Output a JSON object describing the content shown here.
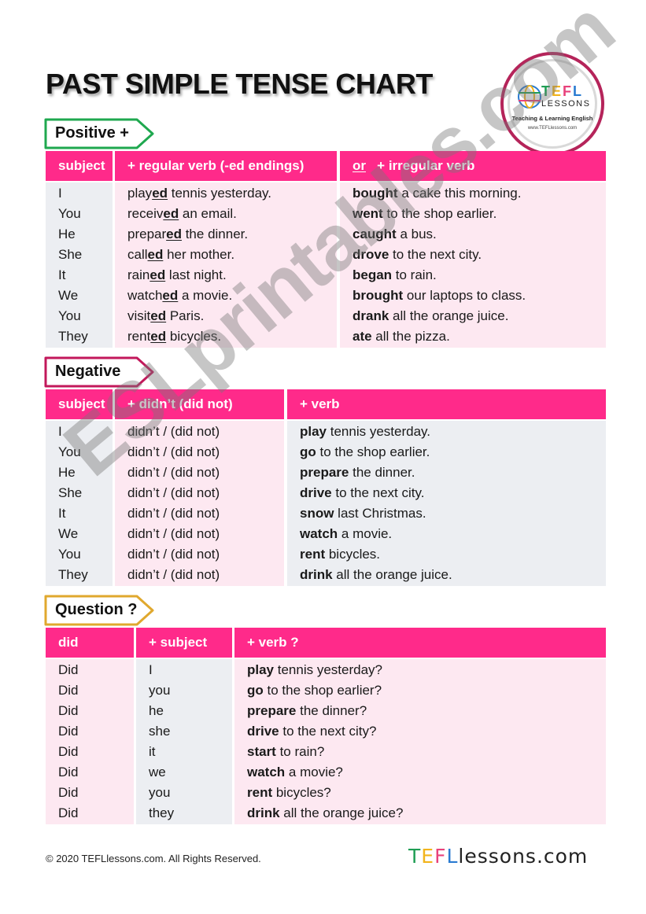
{
  "title": "PAST SIMPLE TENSE CHART",
  "logo": {
    "letters": [
      "T",
      "E",
      "F",
      "L"
    ],
    "lessons": "LESSONS",
    "tagline": "Teaching  & Learning English",
    "url": "www.TEFLlessons.com"
  },
  "colors": {
    "header": "#ff2a8a",
    "positive_tab": "#1fa84f",
    "negative_tab": "#c2185b",
    "question_tab": "#e0a82e",
    "pink_cell": "#fde8f1",
    "grey_cell": "#eceef2"
  },
  "positive": {
    "tab_label": "Positive +",
    "headers": [
      "subject",
      "+ regular verb (-ed endings)",
      "or",
      "+ irregular verb"
    ],
    "subjects": [
      "I",
      "You",
      "He",
      "She",
      "It",
      "We",
      "You",
      "They"
    ],
    "regular": [
      {
        "stem": "play",
        "ending": "ed",
        "rest": " tennis yesterday."
      },
      {
        "stem": "receiv",
        "ending": "ed",
        "rest": " an email."
      },
      {
        "stem": "prepar",
        "ending": "ed",
        "rest": " the dinner."
      },
      {
        "stem": "call",
        "ending": "ed",
        "rest": " her mother."
      },
      {
        "stem": "rain",
        "ending": "ed",
        "rest": " last night."
      },
      {
        "stem": "watch",
        "ending": "ed",
        "rest": " a movie."
      },
      {
        "stem": "visit",
        "ending": "ed",
        "rest": " Paris."
      },
      {
        "stem": "rent",
        "ending": "ed",
        "rest": " bicycles."
      }
    ],
    "irregular": [
      {
        "verb": "bought",
        "rest": " a cake this morning."
      },
      {
        "verb": "went",
        "rest": " to the shop earlier."
      },
      {
        "verb": "caught",
        "rest": " a bus."
      },
      {
        "verb": "drove",
        "rest": " to the next city."
      },
      {
        "verb": "began",
        "rest": " to rain."
      },
      {
        "verb": "brought",
        "rest": " our laptops to class."
      },
      {
        "verb": "drank",
        "rest": " all the orange juice."
      },
      {
        "verb": "ate",
        "rest": " all the pizza."
      }
    ]
  },
  "negative": {
    "tab_label": "Negative",
    "headers": [
      "subject",
      "+ didn’t (did not)",
      "+ verb"
    ],
    "subjects": [
      "I",
      "You",
      "He",
      "She",
      "It",
      "We",
      "You",
      "They"
    ],
    "auxiliary": [
      "didn’t / (did not)",
      "didn’t / (did not)",
      "didn’t / (did not)",
      "didn’t / (did not)",
      "didn’t / (did not)",
      "didn’t / (did not)",
      "didn’t / (did not)",
      "didn’t / (did not)"
    ],
    "verbs": [
      {
        "verb": "play",
        "rest": " tennis yesterday."
      },
      {
        "verb": "go",
        "rest": " to the shop earlier."
      },
      {
        "verb": "prepare",
        "rest": " the dinner."
      },
      {
        "verb": "drive",
        "rest": " to the next city."
      },
      {
        "verb": "snow",
        "rest": " last Christmas."
      },
      {
        "verb": "watch",
        "rest": " a movie."
      },
      {
        "verb": "rent",
        "rest": " bicycles."
      },
      {
        "verb": "drink",
        "rest": " all the orange juice."
      }
    ]
  },
  "question": {
    "tab_label": "Question ?",
    "headers": [
      "did",
      "+ subject",
      "+ verb ?"
    ],
    "did": [
      "Did",
      "Did",
      "Did",
      "Did",
      "Did",
      "Did",
      "Did",
      "Did"
    ],
    "subjects": [
      "I",
      "you",
      "he",
      "she",
      "it",
      "we",
      "you",
      "they"
    ],
    "verbs": [
      {
        "verb": "play",
        "rest": " tennis yesterday?"
      },
      {
        "verb": "go",
        "rest": " to the shop earlier?"
      },
      {
        "verb": "prepare",
        "rest": " the dinner?"
      },
      {
        "verb": "drive",
        "rest": " to the next city?"
      },
      {
        "verb": "start",
        "rest": " to rain?"
      },
      {
        "verb": "watch",
        "rest": " a movie?"
      },
      {
        "verb": "rent",
        "rest": " bicycles?"
      },
      {
        "verb": "drink",
        "rest": " all the orange juice?"
      }
    ]
  },
  "watermark": "ESLprintables.com",
  "footer": {
    "copyright": "© 2020 TEFLlessons.com. All Rights Reserved.",
    "logo_parts": [
      "T",
      "E",
      "F",
      "L",
      "lessons.com"
    ]
  }
}
